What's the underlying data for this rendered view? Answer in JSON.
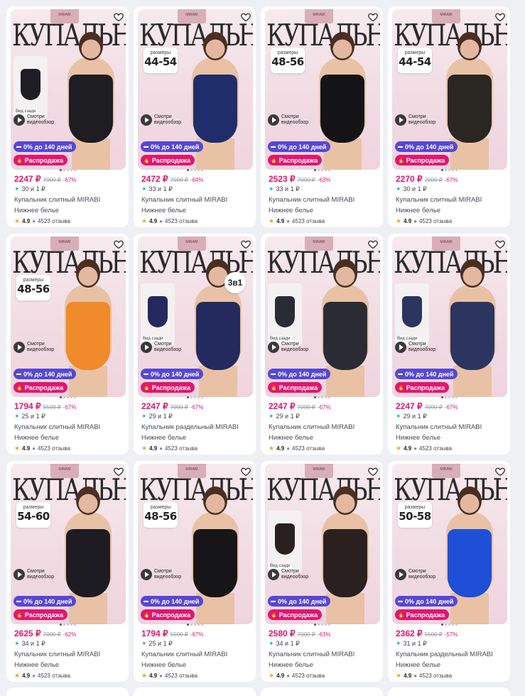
{
  "labels": {
    "installment": "0% до 140 дней",
    "sale": "Распродажа",
    "brand_word": "КУПАЛЬНИК",
    "sizes_caption": "размеры",
    "video": "Смотри видеообзор",
    "back_view": "Вид сзади",
    "reviews": "4523 отзыва",
    "rating": "4.9",
    "category": "Нижнее белье",
    "logo": "MIRABI"
  },
  "colors": {
    "accent_pink": "#e3166f",
    "installment_purple": "#5547d8",
    "bonus_teal": "#18b4c9",
    "star": "#f5a623"
  },
  "products": [
    {
      "price": "2247 ₽",
      "old_price": "7000 ₽",
      "discount": "-67%",
      "bonus": "30 и 1 ₽",
      "title": "Купальник слитный MIRABI",
      "sizes": "",
      "suit_color": "#1d1d22",
      "has_back": true,
      "has_3in1": false
    },
    {
      "price": "2472 ₽",
      "old_price": "7000 ₽",
      "discount": "-64%",
      "bonus": "33 и 1 ₽",
      "title": "Купальник слитный MIRABI",
      "sizes": "44-54",
      "suit_color": "#1f2d6b",
      "has_back": false,
      "has_3in1": false
    },
    {
      "price": "2523 ₽",
      "old_price": "7000 ₽",
      "discount": "-63%",
      "bonus": "33 и 1 ₽",
      "title": "Купальник слитный MIRABI",
      "sizes": "48-56",
      "suit_color": "#141416",
      "has_back": false,
      "has_3in1": false
    },
    {
      "price": "2270 ₽",
      "old_price": "7000 ₽",
      "discount": "-67%",
      "bonus": "30 и 1 ₽",
      "title": "Купальник слитный MIRABI",
      "sizes": "44-54",
      "suit_color": "#2a2622",
      "has_back": false,
      "has_3in1": false
    },
    {
      "price": "1794 ₽",
      "old_price": "5500 ₽",
      "discount": "-67%",
      "bonus": "25 и 1 ₽",
      "title": "Купальник слитный MIRABI",
      "sizes": "48-56",
      "suit_color": "#f08a2a",
      "has_back": false,
      "has_3in1": false
    },
    {
      "price": "2247 ₽",
      "old_price": "7000 ₽",
      "discount": "-67%",
      "bonus": "29 и 1 ₽",
      "title": "Купальник раздельный MIRABI",
      "sizes": "",
      "suit_color": "#24295e",
      "has_back": true,
      "has_3in1": true
    },
    {
      "price": "2247 ₽",
      "old_price": "7000 ₽",
      "discount": "-67%",
      "bonus": "29 и 1 ₽",
      "title": "Купальник слитный MIRABI",
      "sizes": "",
      "suit_color": "#2b2c33",
      "has_back": true,
      "has_3in1": false
    },
    {
      "price": "2247 ₽",
      "old_price": "7000 ₽",
      "discount": "-67%",
      "bonus": "29 и 1 ₽",
      "title": "Купальник слитный MIRABI",
      "sizes": "",
      "suit_color": "#2b3560",
      "has_back": true,
      "has_3in1": false
    },
    {
      "price": "2625 ₽",
      "old_price": "7000 ₽",
      "discount": "-62%",
      "bonus": "34 и 1 ₽",
      "title": "Купальник слитный MIRABI",
      "sizes": "54-60",
      "suit_color": "#1c1c22",
      "has_back": false,
      "has_3in1": false
    },
    {
      "price": "1794 ₽",
      "old_price": "5500 ₽",
      "discount": "-67%",
      "bonus": "25 и 1 ₽",
      "title": "Купальник слитный MIRABI",
      "sizes": "48-56",
      "suit_color": "#161618",
      "has_back": false,
      "has_3in1": false
    },
    {
      "price": "2580 ₽",
      "old_price": "7000 ₽",
      "discount": "-63%",
      "bonus": "34 и 1 ₽",
      "title": "Купальник слитный MIRABI",
      "sizes": "",
      "suit_color": "#2a2020",
      "has_back": true,
      "has_3in1": false
    },
    {
      "price": "2362 ₽",
      "old_price": "5500 ₽",
      "discount": "-57%",
      "bonus": "31 и 1 ₽",
      "title": "Купальник раздельный MIRABI",
      "sizes": "50-58",
      "suit_color": "#1f4fd6",
      "has_back": false,
      "has_3in1": false
    }
  ]
}
